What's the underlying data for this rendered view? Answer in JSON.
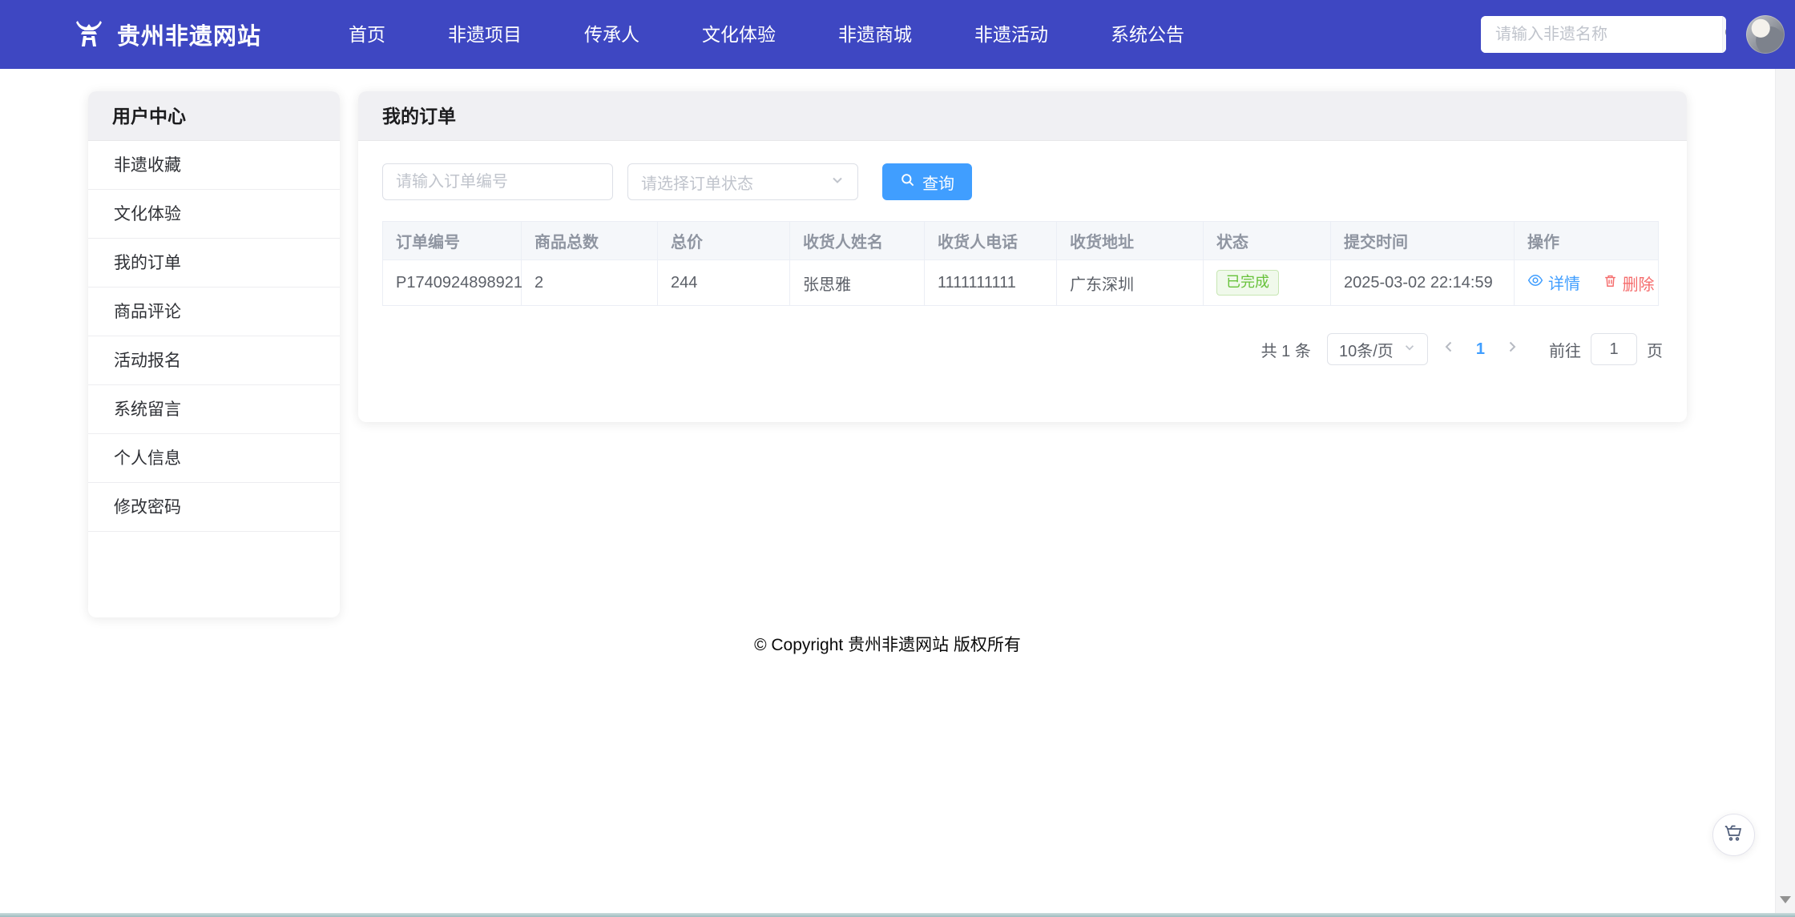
{
  "navbar": {
    "brand": "贵州非遗网站",
    "items": [
      "首页",
      "非遗项目",
      "传承人",
      "文化体验",
      "非遗商城",
      "非遗活动",
      "系统公告"
    ],
    "search_placeholder": "请输入非遗名称"
  },
  "sidebar": {
    "title": "用户中心",
    "items": [
      "非遗收藏",
      "文化体验",
      "我的订单",
      "商品评论",
      "活动报名",
      "系统留言",
      "个人信息",
      "修改密码"
    ]
  },
  "main": {
    "title": "我的订单",
    "filters": {
      "order_no_placeholder": "请输入订单编号",
      "status_placeholder": "请选择订单状态",
      "query_label": "查询"
    },
    "table": {
      "columns": [
        "订单编号",
        "商品总数",
        "总价",
        "收货人姓名",
        "收货人电话",
        "收货地址",
        "状态",
        "提交时间",
        "操作"
      ],
      "rows": [
        {
          "order_no": "P1740924898921",
          "quantity": "2",
          "total_price": "244",
          "receiver_name": "张思雅",
          "receiver_phone": "1111111111",
          "address": "广东深圳",
          "status": "已完成",
          "submit_time": "2025-03-02 22:14:59",
          "action_detail": "详情",
          "action_delete": "删除"
        }
      ]
    },
    "pagination": {
      "total_text": "共 1 条",
      "page_size": "10条/页",
      "current_page": "1",
      "goto_prefix": "前往",
      "goto_value": "1",
      "goto_suffix": "页"
    }
  },
  "footer": {
    "copyright": "© Copyright 贵州非遗网站 版权所有"
  },
  "colors": {
    "navbar_bg": "#3e47c2",
    "primary": "#409eff",
    "success_text": "#67c23a",
    "success_bg": "#f0f9eb",
    "success_border": "#c7e6b3",
    "danger": "#f56c6c",
    "table_header_bg": "#f5f7fa",
    "card_header_bg": "#f0f0f3"
  }
}
